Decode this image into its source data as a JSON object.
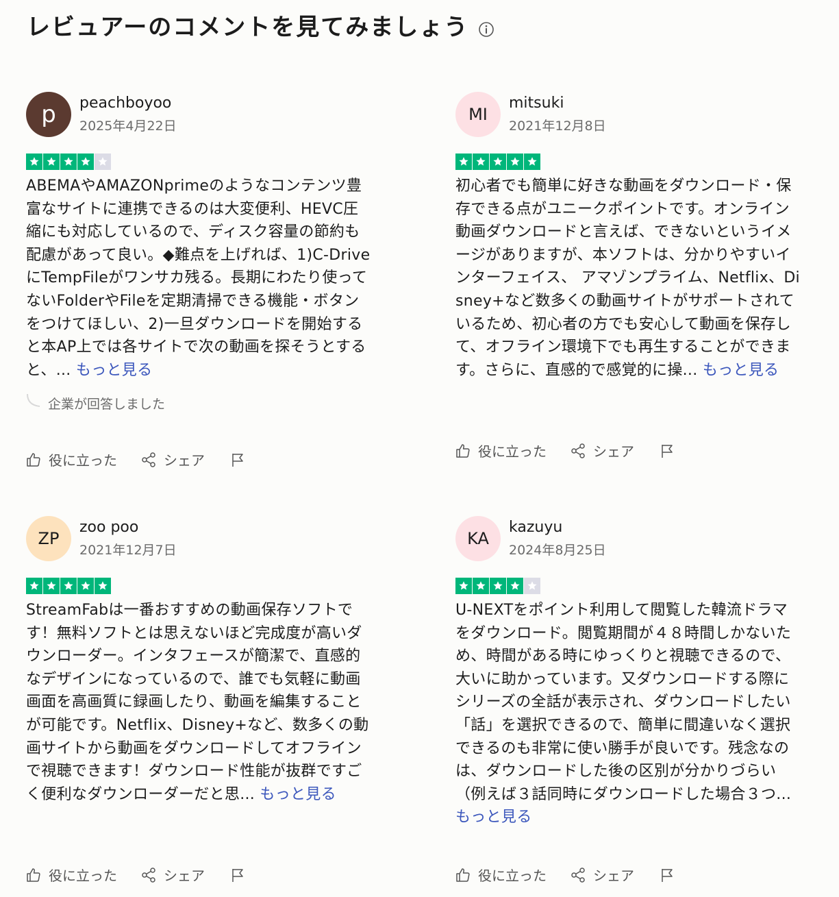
{
  "page": {
    "title": "レビュアーのコメントを見てみましょう",
    "info_icon": "info-circle-icon"
  },
  "colors": {
    "star_green": "#00b67a",
    "star_empty": "#dcdce6",
    "link_blue": "#3c57bc",
    "text_gray": "#6b6b6b"
  },
  "actions": {
    "helpful": "役に立った",
    "share": "シェア",
    "report_icon": "flag-icon",
    "helpful_icon": "thumbs-up-icon",
    "share_icon": "share-icon"
  },
  "reviews": [
    {
      "avatar_text": "p",
      "avatar_bg": "#5b3a30",
      "avatar_color": "#ffffff",
      "name": "peachboyoo",
      "date": "2025年4月22日",
      "rating": 4,
      "text": "ABEMAやAMAZONprimeのようなコンテンツ豊富なサイトに連携できるのは大変便利、HEVC圧縮にも対応しているので、ディスク容量の節約も配慮があって良い。◆難点を上げれば、1)C-DriveにTempFileがワンサカ残る。長期にわたり使ってないFolderやFileを定期清掃できる機能・ボタンをつけてほしい、2)一旦ダウンロードを開始すると本AP上では各サイトで次の動画を探そうとすると、...",
      "more": "もっと見る",
      "company_reply": "企業が回答しました"
    },
    {
      "avatar_text": "MI",
      "avatar_bg": "#fde0e4",
      "avatar_color": "#1c1c1c",
      "name": "mitsuki",
      "date": "2021年12月8日",
      "rating": 5,
      "text": "初心者でも簡単に好きな動画をダウンロード・保存できる点がユニークポイントです。オンライン動画ダウンロードと言えば、できないというイメージがありますが、本ソフトは、分かりやすいインターフェイス、 アマゾンプライム、Netflix、Disney+など数多くの動画サイトがサポートされているため、初心者の方でも安心して動画を保存して、オフライン環境下でも再生することができます。さらに、直感的で感覚的に操...",
      "more": "もっと見る",
      "company_reply": ""
    },
    {
      "avatar_text": "ZP",
      "avatar_bg": "#fde2bd",
      "avatar_color": "#1c1c1c",
      "name": "zoo poo",
      "date": "2021年12月7日",
      "rating": 5,
      "text": "StreamFabは一番おすすめの動画保存ソフトです！無料ソフトとは思えないほど完成度が高いダウンローダー。インタフェースが簡潔で、直感的なデザインになっているので、誰でも気軽に動画画面を高画質に録画したり、動画を編集することが可能です。Netflix、Disney+など、数多くの動画サイトから動画をダウンロードしてオフラインで視聴できます！ダウンロード性能が抜群ですごく便利なダウンローダーだと思...",
      "more": "もっと見る",
      "company_reply": ""
    },
    {
      "avatar_text": "KA",
      "avatar_bg": "#fde0e4",
      "avatar_color": "#1c1c1c",
      "name": "kazuyu",
      "date": "2024年8月25日",
      "rating": 4,
      "text": "U-NEXTをポイント利用して閲覧した韓流ドラマをダウンロード。閲覧期間が４８時間しかないため、時間がある時にゆっくりと視聴できるので、大いに助かっています。又ダウンロードする際にシリーズの全話が表示され、ダウンロードしたい「話」を選択できるので、簡単に間違いなく選択できるのも非常に使い勝手が良いです。残念なのは、ダウンロードした後の区別が分かりづらい（例えば３話同時にダウンロードした場合３つ...",
      "more": "もっと見る",
      "company_reply": ""
    }
  ]
}
